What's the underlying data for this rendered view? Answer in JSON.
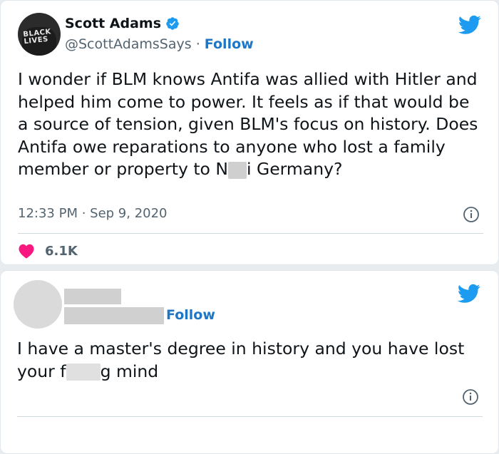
{
  "colors": {
    "twitter_blue": "#1d9bf0",
    "follow_link": "#1d76c6",
    "heart": "#f91880",
    "muted": "#536471"
  },
  "tweet1": {
    "author_name": "Scott Adams",
    "verified": true,
    "handle": "@ScottAdamsSays",
    "separator": "·",
    "follow_label": "Follow",
    "avatar_text": "BLACK LIVES",
    "text_part1": "I wonder if BLM knows Antifa was allied with Hitler and helped him come to power. It feels as if that would be a source of tension, given BLM's focus on history. Does Antifa owe reparations to anyone who lost a family member or property to N",
    "text_part2": "i",
    "text_part3": "Germany?",
    "timestamp": "12:33 PM · Sep 9, 2020",
    "like_count": "6.1K",
    "icons": [
      "twitter-bird-icon",
      "verified-badge-icon",
      "info-icon",
      "heart-icon"
    ]
  },
  "tweet2": {
    "follow_label": "Follow",
    "text_part1": "I have a master's degree in history and you have lost your f",
    "text_part2": "g  mind",
    "icons": [
      "twitter-bird-icon",
      "info-icon"
    ]
  }
}
